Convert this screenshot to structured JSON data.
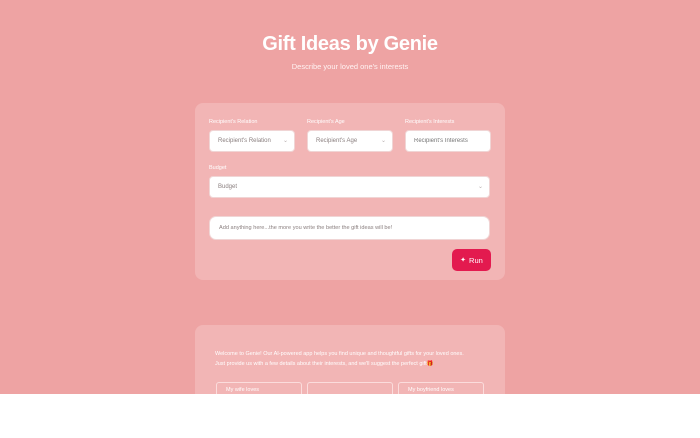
{
  "header": {
    "title": "Gift Ideas by Genie",
    "subtitle": "Describe your loved one's interests"
  },
  "form": {
    "relation_label": "Recipient's Relation",
    "relation_value": "Recipient's Relation",
    "age_label": "Recipient's Age",
    "age_value": "Recipient's Age",
    "interests_label": "Recipient's Interests",
    "interests_placeholder": "Recipient's Interests",
    "budget_label": "Budget",
    "budget_value": "Budget",
    "notes_placeholder": "Add anything here...the more you write the better the gift ideas will be!",
    "run_label": "Run",
    "run_icon": "sparkle-icon"
  },
  "info": {
    "line1": "Welcome to Genie! Our AI-powered app helps you find unique and thoughtful gifts for your loved ones.",
    "line2": "Just provide us with a few details about their interests, and we'll suggest the perfect gift",
    "gift_icon": "🎁",
    "examples": [
      "My wife loves",
      "",
      "My boyfriend loves"
    ]
  },
  "colors": {
    "background": "#eea3a3",
    "card": "#f2b5b5",
    "accent": "#e31a4f"
  }
}
